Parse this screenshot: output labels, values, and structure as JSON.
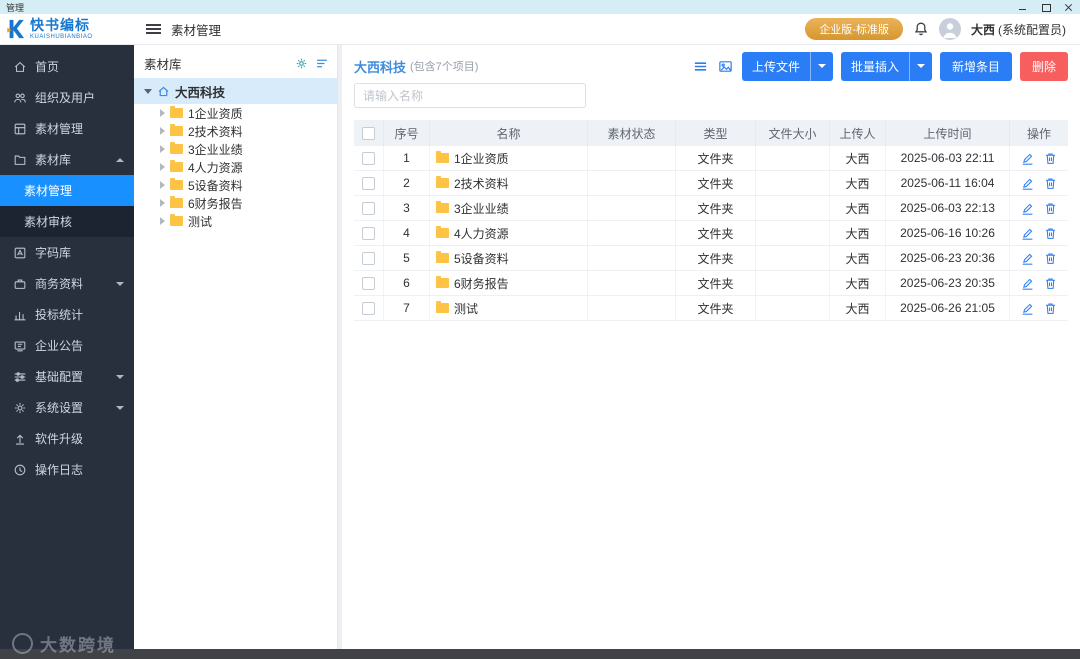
{
  "window": {
    "title": "管理"
  },
  "header": {
    "logo_title": "快书编标",
    "logo_subtitle": "KUAISHUBIANBIAO",
    "breadcrumb": "素材管理",
    "edition_badge": "企业版-标准版",
    "user_name": "大西",
    "user_role": "(系统配置员)"
  },
  "sidebar": {
    "home": "首页",
    "org": "组织及用户",
    "material": "素材管理",
    "library": "素材库",
    "sub_manage": "素材管理",
    "sub_review": "素材审核",
    "fonts": "字码库",
    "business": "商务资料",
    "stats": "投标统计",
    "notice": "企业公告",
    "config": "基础配置",
    "settings": "系统设置",
    "upgrade": "软件升级",
    "logs": "操作日志",
    "watermark": "大数跨境"
  },
  "tree": {
    "panel_title": "素材库",
    "root_label": "大西科技",
    "children": [
      "1企业资质",
      "2技术资料",
      "3企业业绩",
      "4人力资源",
      "5设备资料",
      "6财务报告",
      "测试"
    ]
  },
  "content": {
    "title": "大西科技",
    "subtitle": "(包含7个项目)",
    "upload_button": "上传文件",
    "batch_button": "批量插入",
    "add_button": "新增条目",
    "delete_button": "删除",
    "search_placeholder": "请输入名称",
    "table": {
      "columns": [
        "序号",
        "名称",
        "素材状态",
        "类型",
        "文件大小",
        "上传人",
        "上传时间",
        "操作"
      ],
      "rows": [
        {
          "index": "1",
          "name": "1企业资质",
          "status": "",
          "type": "文件夹",
          "size": "",
          "uploader": "大西",
          "time": "2025-06-03 22:11"
        },
        {
          "index": "2",
          "name": "2技术资料",
          "status": "",
          "type": "文件夹",
          "size": "",
          "uploader": "大西",
          "time": "2025-06-11 16:04"
        },
        {
          "index": "3",
          "name": "3企业业绩",
          "status": "",
          "type": "文件夹",
          "size": "",
          "uploader": "大西",
          "time": "2025-06-03 22:13"
        },
        {
          "index": "4",
          "name": "4人力资源",
          "status": "",
          "type": "文件夹",
          "size": "",
          "uploader": "大西",
          "time": "2025-06-16 10:26"
        },
        {
          "index": "5",
          "name": "5设备资料",
          "status": "",
          "type": "文件夹",
          "size": "",
          "uploader": "大西",
          "time": "2025-06-23 20:36"
        },
        {
          "index": "6",
          "name": "6财务报告",
          "status": "",
          "type": "文件夹",
          "size": "",
          "uploader": "大西",
          "time": "2025-06-23 20:35"
        },
        {
          "index": "7",
          "name": "测试",
          "status": "",
          "type": "文件夹",
          "size": "",
          "uploader": "大西",
          "time": "2025-06-26 21:05"
        }
      ]
    }
  }
}
